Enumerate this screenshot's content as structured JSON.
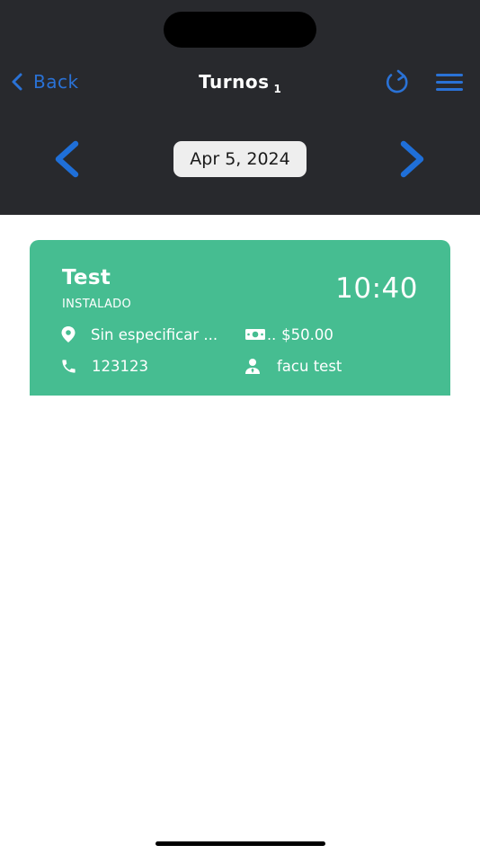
{
  "header": {
    "back_label": "Back",
    "title": "Turnos",
    "count": "1"
  },
  "date_nav": {
    "date": "Apr 5, 2024"
  },
  "appointment": {
    "name": "Test",
    "status": "INSTALADO",
    "time": "10:40",
    "location": "Sin especificar ...",
    "price_ellipsis": "..",
    "price": "$50.00",
    "phone": "123123",
    "employee": "facu test"
  },
  "colors": {
    "header_bg": "#28292d",
    "accent": "#2a72d6",
    "card_bg": "#46bd91"
  },
  "icons": {
    "back": "chevron-left-icon",
    "refresh": "refresh-icon",
    "menu": "hamburger-menu-icon",
    "prev": "chevron-left-icon",
    "next": "chevron-right-icon",
    "location": "map-pin-icon",
    "cash": "cash-icon",
    "phone": "phone-icon",
    "employee": "person-tie-icon"
  }
}
